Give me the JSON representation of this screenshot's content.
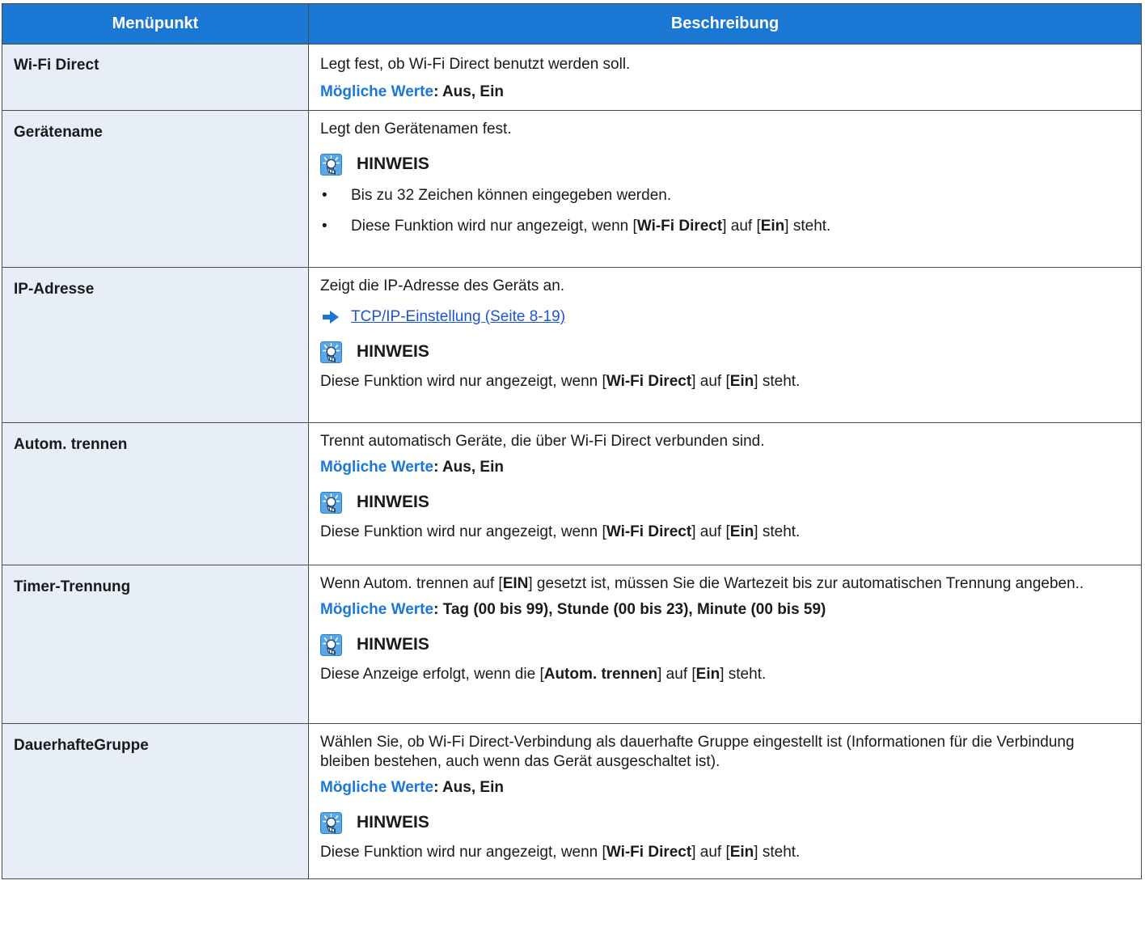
{
  "header": {
    "col_item": "Menüpunkt",
    "col_desc": "Beschreibung"
  },
  "rows": [
    {
      "item": "Wi-Fi Direct",
      "desc": "Legt fest, ob Wi-Fi Direct benutzt werden soll.",
      "values_label": "Mögliche Werte",
      "values": ": Aus, Ein"
    },
    {
      "item": "Gerätename",
      "desc": "Legt den Gerätenamen fest.",
      "note_title": "HINWEIS",
      "bullet_char": "•",
      "note_items": [
        "Bis zu 32 Zeichen können eingegeben werden.",
        {
          "pre": "Diese Funktion wird nur angezeigt, wenn [",
          "k1": "Wi-Fi Direct",
          "mid": "] auf [",
          "k2": "Ein",
          "post": "] steht."
        }
      ]
    },
    {
      "item": "IP-Adresse",
      "desc": "Zeigt die IP-Adresse des Geräts an.",
      "link": "TCP/IP-Einstellung (Seite 8-19)",
      "note_title": "HINWEIS",
      "note": {
        "pre": "Diese Funktion wird nur angezeigt, wenn [",
        "k1": "Wi-Fi Direct",
        "mid": "] auf [",
        "k2": "Ein",
        "post": "] steht."
      }
    },
    {
      "item": "Autom. trennen",
      "desc": "Trennt automatisch Geräte, die über Wi-Fi Direct verbunden sind.",
      "values_label": "Mögliche Werte",
      "values": ": Aus, Ein",
      "note_title": "HINWEIS",
      "note": {
        "pre": "Diese Funktion wird nur angezeigt, wenn [",
        "k1": "Wi-Fi Direct",
        "mid": "] auf [",
        "k2": "Ein",
        "post": "] steht."
      }
    },
    {
      "item": "Timer-Trennung",
      "desc": {
        "pre": "Wenn Autom. trennen auf [",
        "k1": "EIN",
        "post": "] gesetzt ist, müssen Sie die Wartezeit bis zur automatischen Trennung angeben.."
      },
      "values_label": "Mögliche Werte",
      "values": ": Tag (00 bis 99), Stunde (00 bis 23), Minute (00 bis 59)",
      "note_title": "HINWEIS",
      "note": {
        "pre": "Diese Anzeige erfolgt, wenn die [",
        "k1": "Autom. trennen",
        "mid": "] auf [",
        "k2": "Ein",
        "post": "] steht."
      }
    },
    {
      "item": "DauerhafteGruppe",
      "desc": "Wählen Sie, ob Wi-Fi Direct-Verbindung als dauerhafte Gruppe eingestellt ist (Informationen für die Verbindung bleiben bestehen, auch wenn das Gerät ausgeschaltet ist).",
      "values_label": "Mögliche Werte",
      "values": ": Aus, Ein",
      "note_title": "HINWEIS",
      "note": {
        "pre": "Diese Funktion wird nur angezeigt, wenn [",
        "k1": "Wi-Fi Direct",
        "mid": "] auf [",
        "k2": "Ein",
        "post": "] steht."
      }
    }
  ]
}
